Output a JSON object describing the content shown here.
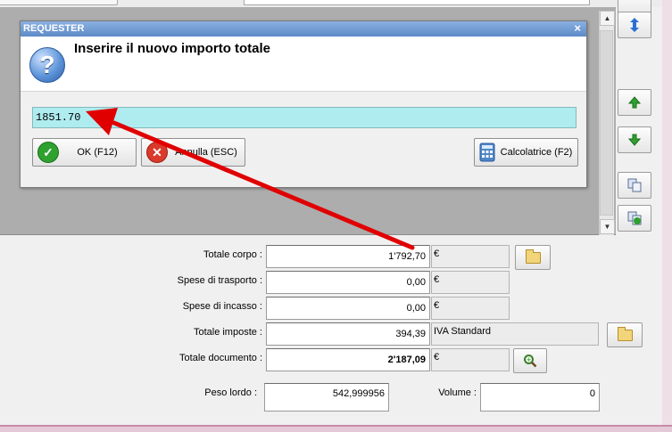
{
  "colors": {
    "titlebar": "#5d8bc8",
    "value_field": "#aeecef",
    "arrow": "#e00000"
  },
  "dialog": {
    "title": "REQUESTER",
    "close": "×",
    "prompt": "Inserire il nuovo importo totale",
    "value": "1851.70",
    "ok_label": "OK (F12)",
    "cancel_label": "Annulla (ESC)",
    "calc_label": "Calcolatrice (F2)"
  },
  "totals": {
    "corpo_label": "Totale corpo :",
    "corpo_value": "1'792,70",
    "trasporto_label": "Spese di trasporto :",
    "trasporto_value": "0,00",
    "incasso_label": "Spese di incasso :",
    "incasso_value": "0,00",
    "imposte_label": "Totale imposte :",
    "imposte_value": "394,39",
    "iva_label": "IVA Standard",
    "documento_label": "Totale documento :",
    "documento_value": "2'187,09",
    "currency": "€",
    "peso_label": "Peso lordo :",
    "peso_value": "542,999956",
    "volume_label": "Volume :",
    "volume_value": "0"
  }
}
